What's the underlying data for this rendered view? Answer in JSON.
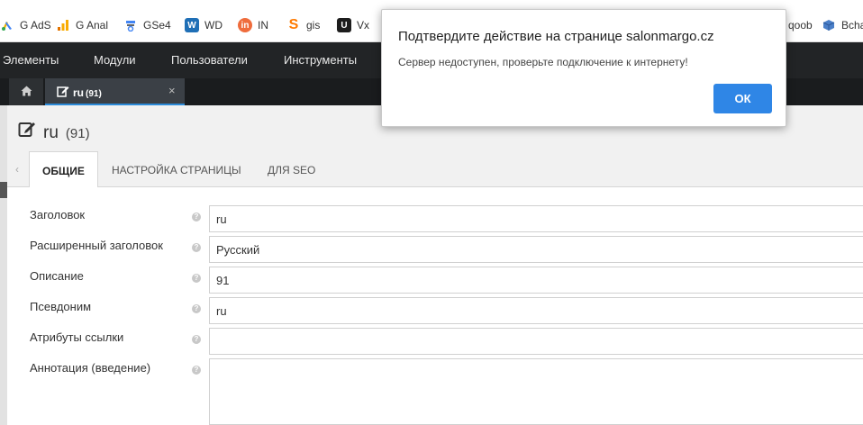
{
  "browser": {
    "bookmarks": [
      {
        "label": "G AdS"
      },
      {
        "label": "G Anal"
      },
      {
        "label": "GSe4"
      },
      {
        "label": "WD"
      },
      {
        "label": "IN"
      },
      {
        "label": "gis"
      },
      {
        "label": "Vx"
      },
      {
        "label": "qoob"
      },
      {
        "label": "Bcha"
      }
    ]
  },
  "nav": {
    "items": [
      "Элементы",
      "Модули",
      "Пользователи",
      "Инструменты"
    ]
  },
  "doc_tabs": {
    "home_icon": "home-icon",
    "active": {
      "label": "ru",
      "count": "(91)",
      "close": "×"
    }
  },
  "page": {
    "title": "ru",
    "count": "(91)",
    "tabs": [
      "ОБЩИЕ",
      "НАСТРОЙКА СТРАНИЦЫ",
      "ДЛЯ SEO"
    ],
    "active_tab": "ОБЩИЕ"
  },
  "form": {
    "fields": [
      {
        "label": "Заголовок",
        "value": "ru"
      },
      {
        "label": "Расширенный заголовок",
        "value": "Русский"
      },
      {
        "label": "Описание",
        "value": "91"
      },
      {
        "label": "Псевдоним",
        "value": "ru"
      },
      {
        "label": "Атрибуты ссылки",
        "value": ""
      },
      {
        "label": "Аннотация (введение)",
        "value": ""
      }
    ],
    "help_glyph": "?"
  },
  "dialog": {
    "title": "Подтвердите действие на странице salonmargo.cz",
    "message": "Сервер недоступен, проверьте подключение к интернету!",
    "ok_label": "ОК"
  },
  "colors": {
    "nav_bg": "#222426",
    "tab_accent": "#2b8ad8",
    "ok_button": "#2f86e6"
  }
}
